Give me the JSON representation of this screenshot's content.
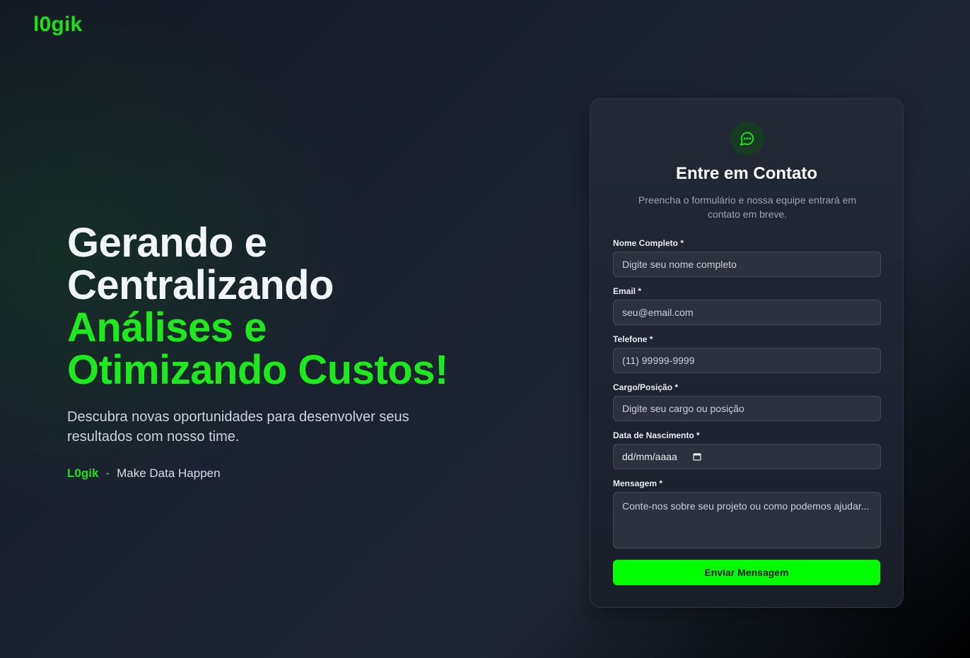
{
  "brand": {
    "logo": "l0gik"
  },
  "hero": {
    "title_line1": "Gerando e",
    "title_line2": "Centralizando",
    "title_line3": "Análises e",
    "title_line4": "Otimizando Custos!",
    "subtitle": "Descubra novas oportunidades para desenvolver seus resultados com nosso time.",
    "tagline_brand": "L0gik",
    "tagline_separator": "-",
    "tagline_text": "Make Data Happen"
  },
  "contact_form": {
    "icon": "chat-bubble-icon",
    "title": "Entre em Contato",
    "subtitle": "Preencha o formulário e nossa equipe entrará em contato em breve.",
    "fields": [
      {
        "label": "Nome Completo *",
        "placeholder": "Digite seu nome completo"
      },
      {
        "label": "Email *",
        "placeholder": "seu@email.com"
      },
      {
        "label": "Telefone *",
        "placeholder": "(11) 99999-9999"
      },
      {
        "label": "Cargo/Posição *",
        "placeholder": "Digite seu cargo ou posição"
      },
      {
        "label": "Data de Nascimento *",
        "placeholder": "dd/mm/aaaa"
      },
      {
        "label": "Mensagem *",
        "placeholder": "Conte-nos sobre seu projeto ou como podemos ajudar..."
      }
    ],
    "submit_label": "Enviar Mensagem"
  },
  "colors": {
    "accent_green": "#00ff00",
    "logo_green": "#1de01d",
    "background_dark": "#1b2230",
    "card_background": "#222935",
    "input_background": "#2b313d"
  }
}
